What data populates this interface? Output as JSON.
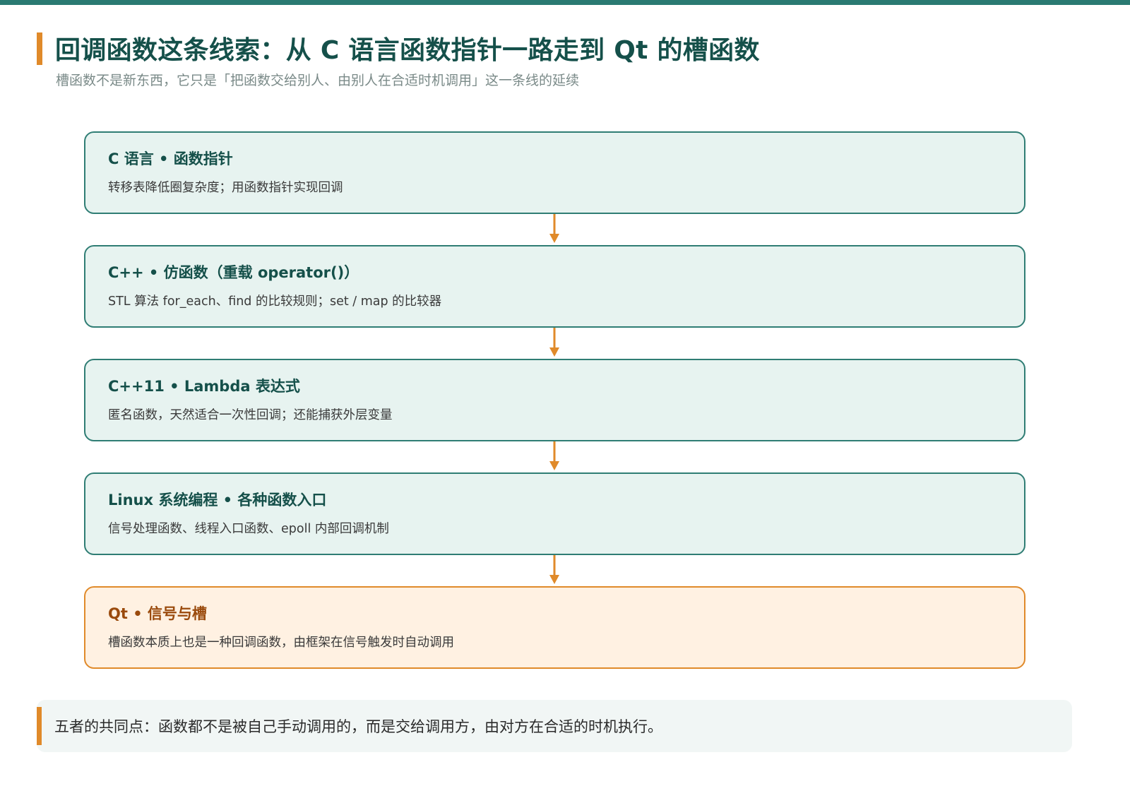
{
  "header": {
    "title": "回调函数这条线索：从 C 语言函数指针一路走到 Qt 的槽函数",
    "subtitle": "槽函数不是新东西，它只是「把函数交给别人、由别人在合适时机调用」这一条线的延续"
  },
  "stages": [
    {
      "title": "C 语言 • 函数指针",
      "desc": "转移表降低圈复杂度；用函数指针实现回调"
    },
    {
      "title": "C++ • 仿函数（重载 operator()）",
      "desc": "STL 算法 for_each、find 的比较规则；set / map 的比较器"
    },
    {
      "title": "C++11 • Lambda 表达式",
      "desc": "匿名函数，天然适合一次性回调；还能捕获外层变量"
    },
    {
      "title": "Linux 系统编程 • 各种函数入口",
      "desc": "信号处理函数、线程入口函数、epoll 内部回调机制"
    },
    {
      "title": "Qt • 信号与槽",
      "desc": "槽函数本质上也是一种回调函数，由框架在信号触发时自动调用"
    }
  ],
  "note": {
    "text": "五者的共同点：函数都不是被自己手动调用的，而是交给调用方，由对方在合适的时机执行。"
  },
  "colors": {
    "accent": "#e08a2a",
    "primary": "#2a7a72",
    "title_text": "#15504a",
    "card_fill": "#e7f3f0",
    "highlight_fill": "#fff1e2"
  }
}
